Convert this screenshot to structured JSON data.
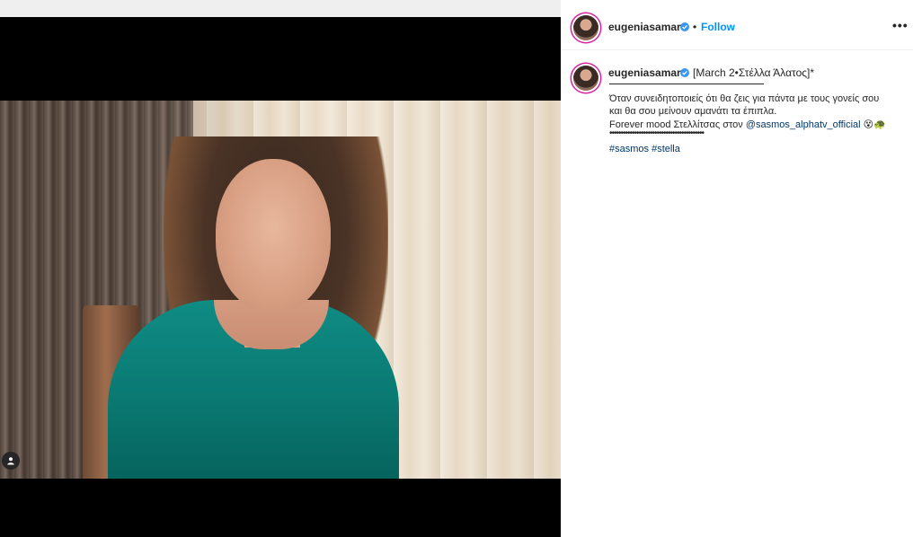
{
  "post": {
    "username": "eugeniasamara",
    "follow_label": "Follow",
    "separator": "•",
    "more_label": "•••"
  },
  "caption": {
    "username": "eugeniasamara",
    "first_line": "[March 2•Στέλλα Άλατος]*",
    "line1": "Όταν συνειδητοποιείς ότι θα ζεις για πάντα με τους γονείς σου",
    "line2": "και θα σου μείνουν αμανάτι τα έπιπλα.",
    "line3_prefix": "Forever mood Στελλίτσας στον ",
    "line3_mention": "@sasmos_alphatv_official",
    "line3_emoji": "😵🐢",
    "dots": "••••••••••••••••••••••••••••••••••••••••••",
    "hashtags": "#sasmos #stella"
  },
  "colors": {
    "accent": "#0095f6",
    "verified": "#3897f0",
    "link": "#00376b",
    "text": "#262626",
    "media_bg": "#000000"
  },
  "icons": {
    "verified": "verified-badge-icon",
    "tag": "user-tag-icon"
  }
}
